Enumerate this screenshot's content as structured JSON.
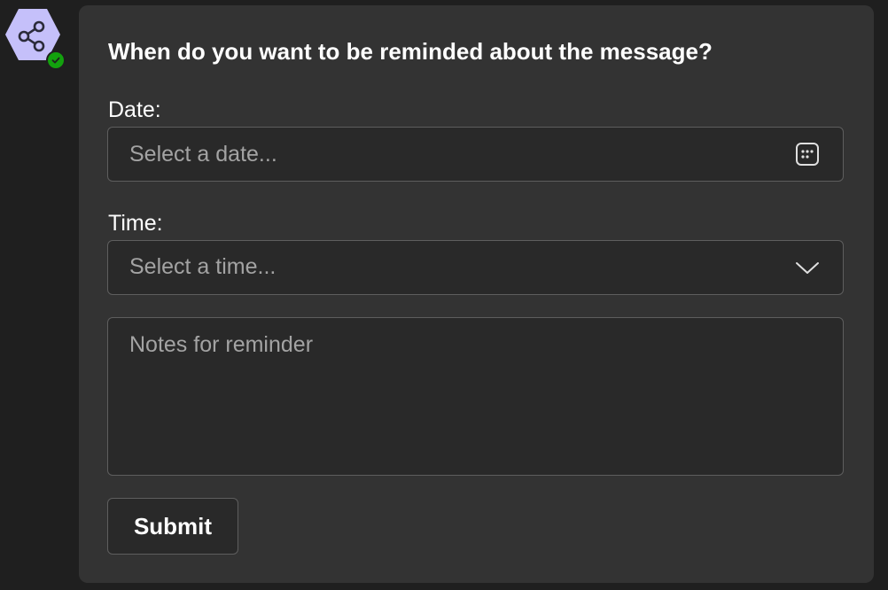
{
  "bot": {
    "avatar_icon": "share-nodes-icon",
    "avatar_color": "#c5c0fa",
    "presence_icon": "checkmark-icon",
    "presence_color": "#13a10e"
  },
  "card": {
    "title": "When do you want to be reminded about the message?",
    "date": {
      "label": "Date:",
      "placeholder": "Select a date...",
      "icon": "calendar-icon"
    },
    "time": {
      "label": "Time:",
      "placeholder": "Select a time...",
      "icon": "chevron-down-icon"
    },
    "notes": {
      "placeholder": "Notes for reminder"
    },
    "submit_label": "Submit"
  }
}
